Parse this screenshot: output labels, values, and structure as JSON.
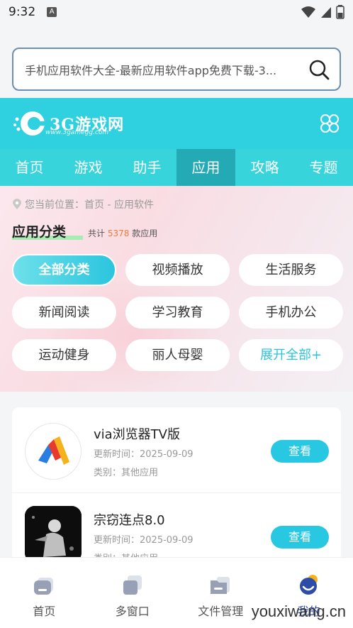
{
  "status": {
    "time": "9:32",
    "a_badge": "A"
  },
  "search": {
    "text": "手机应用软件大全-最新应用软件app免费下载-3..."
  },
  "header": {
    "logo_text": "3G游戏网",
    "logo_sub": "www.3gamegg.com"
  },
  "nav": {
    "items": [
      "首页",
      "游戏",
      "助手",
      "应用",
      "攻略",
      "专题"
    ],
    "active": "应用"
  },
  "category": {
    "breadcrumb": "您当前位置：首页 - 应用软件",
    "title": "应用分类",
    "count_prefix": "共计",
    "count": "5378",
    "count_suffix": "款应用",
    "chips": [
      "全部分类",
      "视频播放",
      "生活服务",
      "新闻阅读",
      "学习教育",
      "手机办公",
      "运动健身",
      "丽人母婴",
      "展开全部+"
    ]
  },
  "apps": [
    {
      "name": "via浏览器TV版",
      "date": "更新时间：2025-09-09",
      "category": "类别：其他应用",
      "button": "查看"
    },
    {
      "name": "宗窃连点8.0",
      "date": "更新时间：2025-09-09",
      "category": "类别：其他应用",
      "button": "查看"
    }
  ],
  "tabbar": {
    "items": [
      "首页",
      "多窗口",
      "文件管理",
      "我的"
    ],
    "active": "我的"
  },
  "watermark": "youxiwang.cn",
  "colors": {
    "accent": "#2fd0e0",
    "nav_active": "#23aab4",
    "button": "#28c8e3",
    "count": "#f07a3a"
  }
}
